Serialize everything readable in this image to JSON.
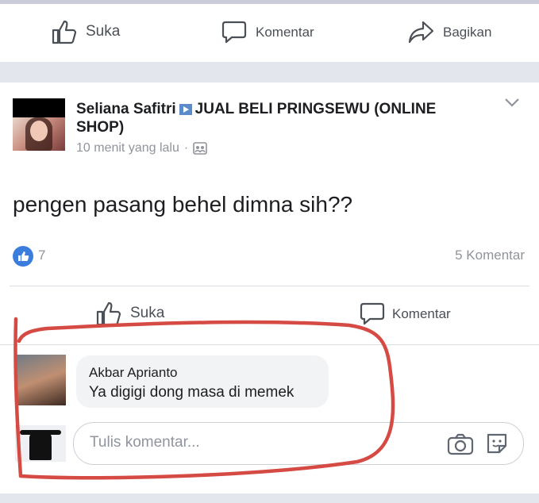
{
  "top_actions": {
    "like_label": "Suka",
    "comment_label": "Komentar",
    "share_label": "Bagikan"
  },
  "post": {
    "author_name": "Seliana Safitri",
    "group_name": "JUAL BELI PRINGSEWU (ONLINE SHOP)",
    "timestamp": "10 menit yang lalu",
    "text": "pengen pasang behel dimna sih??",
    "like_count": "7",
    "comment_count": "5 Komentar",
    "actions": {
      "like_label": "Suka",
      "comment_label": "Komentar"
    }
  },
  "comments": [
    {
      "author": "Akbar Aprianto",
      "text": "Ya digigi dong masa di memek"
    }
  ],
  "comment_input": {
    "placeholder": "Tulis komentar..."
  },
  "colors": {
    "like_blue": "#3b7ddd",
    "annotation_red": "#d64a44",
    "band_gray": "#e4e6ee"
  },
  "icons": [
    "thumbs-up-icon",
    "comment-icon",
    "share-icon",
    "chevron-down-icon",
    "photo-icon",
    "camera-icon",
    "sticker-icon",
    "globe-icon"
  ]
}
